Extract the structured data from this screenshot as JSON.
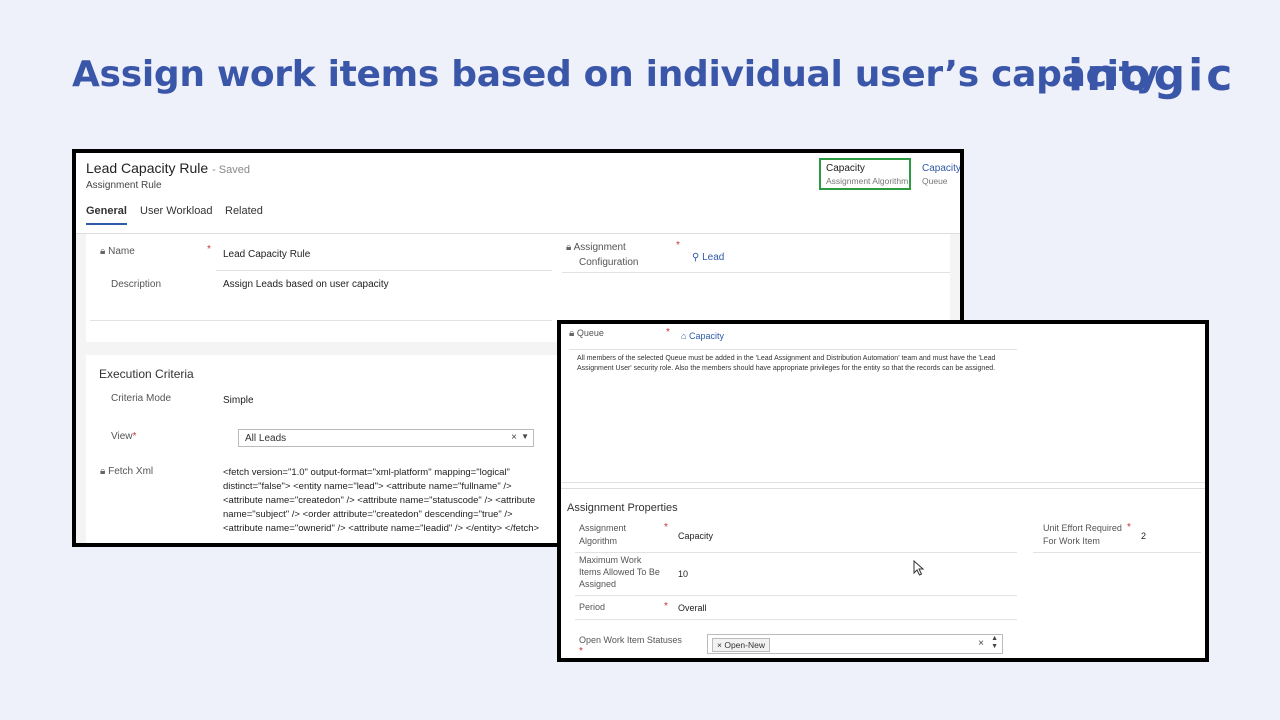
{
  "headline": "Assign work items based on individual user’s capacity",
  "logo": "inogic",
  "record": {
    "title": "Lead Capacity Rule",
    "saved_status": "- Saved",
    "entity": "Assignment Rule",
    "tabs": [
      "General",
      "User Workload",
      "Related"
    ],
    "active_tab": "General",
    "header_fields": [
      {
        "value": "Capacity",
        "label": "Assignment Algorithm"
      },
      {
        "value": "Capacity",
        "label": "Queue"
      }
    ]
  },
  "general": {
    "name_label": "Name",
    "name_value": "Lead Capacity Rule",
    "description_label": "Description",
    "description_value": "Assign Leads based on user capacity",
    "assignment_config_label_1": "Assignment",
    "assignment_config_label_2": "Configuration",
    "assignment_config_value": "Lead"
  },
  "execution": {
    "title": "Execution Criteria",
    "criteria_mode_label": "Criteria Mode",
    "criteria_mode_value": "Simple",
    "view_label": "View",
    "view_value": "All Leads",
    "fetch_label": "Fetch Xml",
    "fetch_value": "<fetch version=\"1.0\" output-format=\"xml-platform\" mapping=\"logical\" distinct=\"false\"> <entity name=\"lead\"> <attribute name=\"fullname\" /> <attribute name=\"createdon\" /> <attribute name=\"statuscode\" /> <attribute name=\"subject\" /> <order attribute=\"createdon\" descending=\"true\" /> <attribute name=\"ownerid\" /> <attribute name=\"leadid\" /> </entity> </fetch>"
  },
  "queue": {
    "label": "Queue",
    "value": "Capacity",
    "note": "All members of the selected Queue must be added in the 'Lead Assignment and Distribution Automation' team and must have the 'Lead Assignment User' security role. Also the members should have appropriate privileges for the entity so that the records can be assigned."
  },
  "assignment_properties": {
    "title": "Assignment Properties",
    "algorithm_label_1": "Assignment",
    "algorithm_label_2": "Algorithm",
    "algorithm_value": "Capacity",
    "max_label_1": "Maximum Work",
    "max_label_2": "Items Allowed To Be",
    "max_label_3": "Assigned",
    "max_value": "10",
    "period_label": "Period",
    "period_value": "Overall",
    "statuses_label": "Open Work Item Statuses",
    "statuses_tag": "Open-New",
    "unit_effort_label_1": "Unit Effort Required",
    "unit_effort_label_2": "For Work Item",
    "unit_effort_value": "2"
  },
  "colors": {
    "headline": "#3a56a8",
    "highlight_box": "#2c9a3e",
    "link": "#2f5aa8"
  }
}
